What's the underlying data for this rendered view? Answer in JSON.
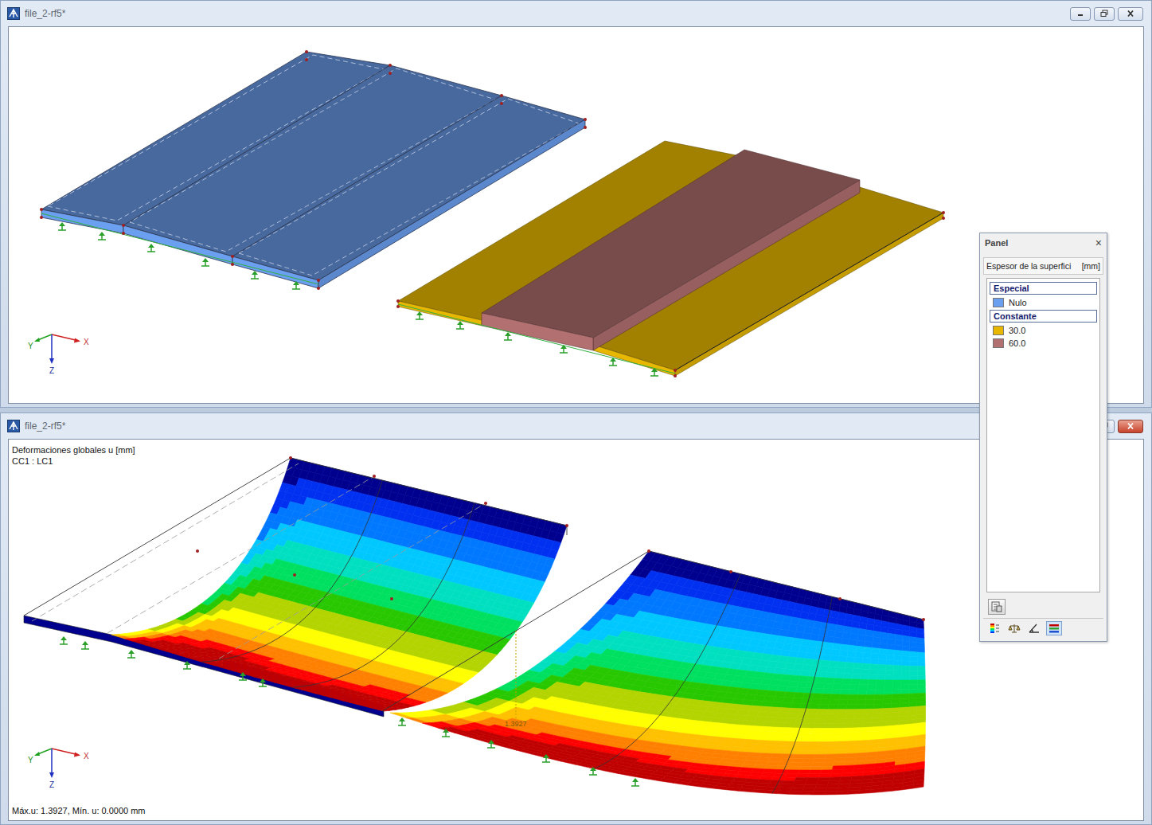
{
  "windows": [
    {
      "title": "file_2-rf5*",
      "axes": {
        "x": "X",
        "y": "Y",
        "z": "Z"
      }
    },
    {
      "title": "file_2-rf5*",
      "axes": {
        "x": "X",
        "y": "Y",
        "z": "Z"
      },
      "result": {
        "title": "Deformaciones globales u [mm]",
        "case": "CC1 : LC1",
        "max_marker": "1.3927",
        "summary": "Máx.u: 1.3927, Mín. u: 0.0000 mm",
        "bands": [
          {
            "color": "#00008f"
          },
          {
            "color": "#0030f0"
          },
          {
            "color": "#0078ff"
          },
          {
            "color": "#00c8ff"
          },
          {
            "color": "#00e0c0"
          },
          {
            "color": "#00e060"
          },
          {
            "color": "#28c800"
          },
          {
            "color": "#b4d400"
          },
          {
            "color": "#ffff00"
          },
          {
            "color": "#ffc000"
          },
          {
            "color": "#ff8000"
          },
          {
            "color": "#ff0000"
          },
          {
            "color": "#c00000"
          }
        ]
      }
    }
  ],
  "panel": {
    "title": "Panel",
    "close": "×",
    "property": "Espesor de la superfici",
    "unit": "[mm]",
    "groups": [
      {
        "label": "Especial",
        "items": [
          {
            "label": "Nulo",
            "color": "#6b9ff0"
          }
        ]
      },
      {
        "label": "Constante",
        "items": [
          {
            "label": "30.0",
            "color": "#e8b800"
          },
          {
            "label": "60.0",
            "color": "#b27070"
          }
        ]
      }
    ],
    "toolbar": [
      {
        "selected": false
      },
      {
        "selected": false
      },
      {
        "selected": false
      },
      {
        "selected": true
      }
    ]
  }
}
